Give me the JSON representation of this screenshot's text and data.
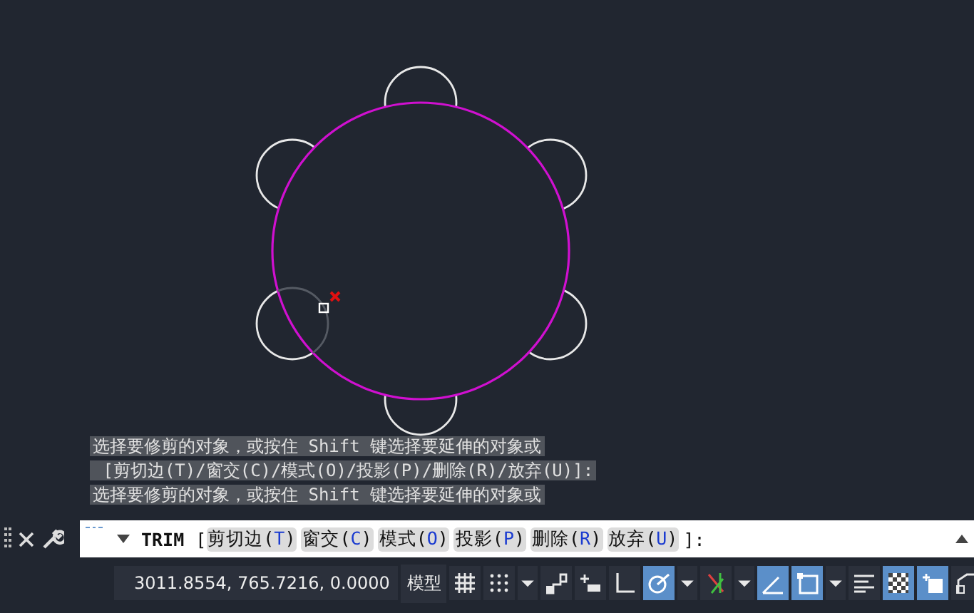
{
  "history": [
    "选择要修剪的对象，或按住 Shift 键选择要延伸的对象或",
    " [剪切边(T)/窗交(C)/模式(O)/投影(P)/删除(R)/放弃(U)]:",
    "选择要修剪的对象，或按住 Shift 键选择要延伸的对象或"
  ],
  "command_line": {
    "command": "TRIM",
    "open": "[",
    "close": "]:",
    "options": [
      {
        "before": "剪切边(",
        "key": "T",
        "after": ")"
      },
      {
        "before": "窗交(",
        "key": "C",
        "after": ")"
      },
      {
        "before": "模式(",
        "key": "O",
        "after": ")"
      },
      {
        "before": "投影(",
        "key": "P",
        "after": ")"
      },
      {
        "before": "删除(",
        "key": "R",
        "after": ")"
      },
      {
        "before": "放弃(",
        "key": "U",
        "after": ")"
      }
    ]
  },
  "status_bar": {
    "coordinates": "3011.8554, 765.7216, 0.0000",
    "space": "模型",
    "items": [
      {
        "kind": "grid",
        "on": false
      },
      {
        "kind": "snap",
        "on": false
      },
      {
        "kind": "caret",
        "on": false
      },
      {
        "kind": "infer",
        "on": false
      },
      {
        "kind": "dynamic",
        "on": false
      },
      {
        "kind": "ortho",
        "on": false
      },
      {
        "kind": "polar",
        "on": true
      },
      {
        "kind": "caret",
        "on": false
      },
      {
        "kind": "track",
        "on": false
      },
      {
        "kind": "caret",
        "on": false
      },
      {
        "kind": "angle",
        "on": true
      },
      {
        "kind": "osnap",
        "on": true
      },
      {
        "kind": "caret",
        "on": false
      },
      {
        "kind": "lineweight",
        "on": false
      },
      {
        "kind": "transparency",
        "on": true
      },
      {
        "kind": "cycling",
        "on": true
      },
      {
        "kind": "annotation",
        "on": false
      }
    ]
  }
}
